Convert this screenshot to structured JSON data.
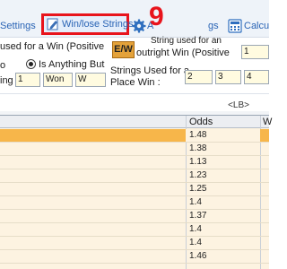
{
  "toolbar": {
    "settings_label": "Settings",
    "winlose_label": "Win/lose Strings",
    "a_label": "A",
    "strings_label": "gs",
    "calc_label": "Calcu",
    "callout_number": "9"
  },
  "config": {
    "used_for_win_label": "used for a Win (Positive",
    "ew_label": "E/W",
    "outright_label_1": "String used for an",
    "outright_label_2": "outright Win (Positive",
    "outright_value": "1",
    "is_anything_but_label": "Is Anything But",
    "o_label": "o",
    "ing_label": "ing",
    "win_strings": [
      "1",
      "Won",
      "W"
    ],
    "place_label_1": "Strings Used for a",
    "place_label_2": "Place Win :",
    "place_values": [
      "2",
      "3",
      "4"
    ]
  },
  "lb_label": "<LB>",
  "grid": {
    "odds_header": "Odds",
    "w_header": "W",
    "rows": [
      {
        "odds": "1.48",
        "selected": true
      },
      {
        "odds": "1.38",
        "selected": false
      },
      {
        "odds": "1.13",
        "selected": false
      },
      {
        "odds": "1.23",
        "selected": false
      },
      {
        "odds": "1.25",
        "selected": false
      },
      {
        "odds": "1.4",
        "selected": false
      },
      {
        "odds": "1.37",
        "selected": false
      },
      {
        "odds": "1.4",
        "selected": false
      },
      {
        "odds": "1.4",
        "selected": false
      },
      {
        "odds": "1.46",
        "selected": false
      }
    ]
  }
}
